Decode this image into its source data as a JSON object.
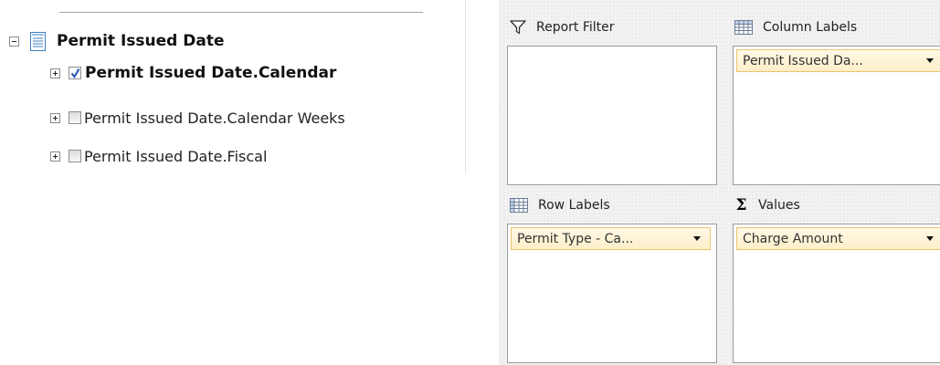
{
  "field_tree": {
    "root": {
      "label": "Permit Issued Date",
      "expanded": true,
      "icon": "document-icon"
    },
    "hierarchies": [
      {
        "label": "Permit Issued Date.Calendar",
        "checked": true,
        "bold": true
      },
      {
        "label": "Permit Issued Date.Calendar Weeks",
        "checked": false,
        "bold": false
      },
      {
        "label": "Permit Issued Date.Fiscal",
        "checked": false,
        "bold": false
      }
    ]
  },
  "pivot_areas": {
    "report_filter": {
      "title": "Report Filter",
      "icon": "filter-icon",
      "fields": []
    },
    "column_labels": {
      "title": "Column Labels",
      "icon": "column-grid-icon",
      "fields": [
        "Permit Issued Da..."
      ]
    },
    "row_labels": {
      "title": "Row Labels",
      "icon": "row-grid-icon",
      "fields": [
        "Permit Type - Ca..."
      ]
    },
    "values": {
      "title": "Values",
      "icon": "sigma-icon",
      "symbol": "Σ",
      "fields": [
        "Charge Amount"
      ]
    }
  },
  "colors": {
    "pill_border": "#eac46c",
    "pill_fill": "#feefc9",
    "check_mark": "#2a5cb3",
    "doc_icon": "#3e7fc1"
  }
}
